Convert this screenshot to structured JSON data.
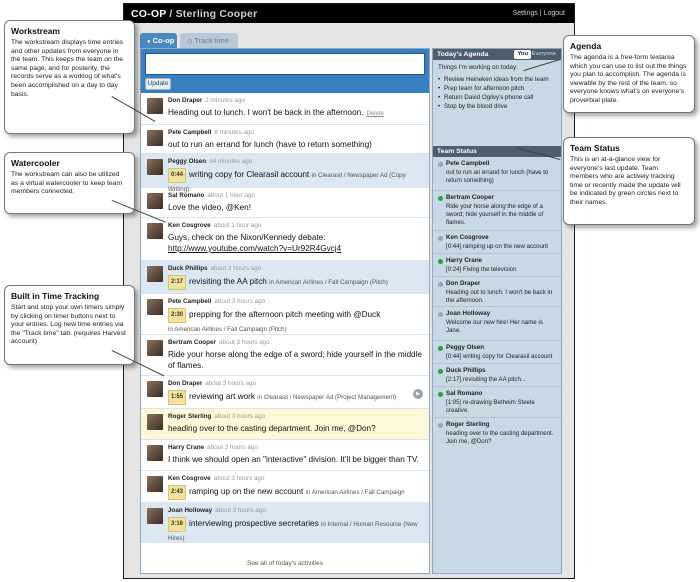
{
  "app": {
    "brand": "CO-OP",
    "separator": " / ",
    "team": "Sterling Cooper",
    "settings": "Settings",
    "links_sep": " | ",
    "logout": "Logout"
  },
  "tabs": {
    "coop": "Co-op",
    "track": "Track time"
  },
  "composer": {
    "update": "Update"
  },
  "entries": [
    {
      "name": "Don Draper",
      "ago": "2 minutes ago",
      "text": "Heading out to lunch. I won't be back in the afternoon.",
      "delete": "Delete"
    },
    {
      "name": "Pete Campbell",
      "ago": "8 minutes ago",
      "text": "out to run an errand for lunch (have to return something)"
    },
    {
      "name": "Peggy Olsen",
      "ago": "34 minutes ago",
      "timer": "0:44",
      "text": "writing copy for Clearasil account",
      "project": "in Clearasil / Newspaper Ad (Copy Writing)"
    },
    {
      "name": "Sal Romano",
      "ago": "about 1 hour ago",
      "text": "Love the video, @Ken!"
    },
    {
      "name": "Ken Cosgrove",
      "ago": "about 1 hour ago",
      "text": "Guys, check on the Nixon/Kennedy debate:",
      "link": "http://www.youtube.com/watch?v=Ur92R4Gvcj4"
    },
    {
      "name": "Duck Phillips",
      "ago": "about 2 hours ago",
      "timer": "2:17",
      "text": "revisiting the AA pitch",
      "project": "in American Airlines / Fall Campaign (Pitch)"
    },
    {
      "name": "Pete Campbell",
      "ago": "about 3 hours ago",
      "timer": "2:30",
      "text": "prepping for the afternoon pitch meeting with @Duck",
      "project": "in American Airlines / Fall Campaign (Pitch)"
    },
    {
      "name": "Bertram Cooper",
      "ago": "about 3 hours ago",
      "text": "Ride your horse along the edge of a sword; hide yourself in the middle of flames."
    },
    {
      "name": "Don Draper",
      "ago": "about 3 hours ago",
      "timer": "1:55",
      "text": "reviewing art work",
      "project": "in Clearasil / Newspaper Ad (Project Management)"
    },
    {
      "name": "Roger Sterling",
      "ago": "about 3 hours ago",
      "text": "heading over to the casting department. Join me, @Don?"
    },
    {
      "name": "Harry Crane",
      "ago": "about 3 hours ago",
      "text": "I think we should open an \"interactive\" division. It'll be bigger than TV."
    },
    {
      "name": "Ken Cosgrove",
      "ago": "about 3 hours ago",
      "timer": "2:43",
      "text": "ramping up on the new account",
      "project": "in American Airlines / Fall Campaign (Pitch)"
    },
    {
      "name": "Joan Holloway",
      "ago": "about 3 hours ago",
      "timer": "3:18",
      "text": "interviewing prospective secretaries",
      "project": "in Internal / Human Resource (New Hires)"
    }
  ],
  "see_all": "See all of today's activities",
  "agenda": {
    "title": "Today's Agenda",
    "you": "You",
    "everyone": "Everyone",
    "intro": "Things I'm working on today:",
    "items": [
      "Review Heineken ideas from the team",
      "Prep team for afternoon pitch",
      "Return David Ogilvy's phone call",
      "Stop by the blood drive"
    ]
  },
  "team_status": {
    "title": "Team Status",
    "members": [
      {
        "name": "Pete Campbell",
        "text": "out to run an errand for lunch (have to return something)",
        "active": false
      },
      {
        "name": "Bertram Cooper",
        "text": "Ride your horse along the edge of a sword; hide yourself in the middle of flames.",
        "active": true
      },
      {
        "name": "Ken Cosgrove",
        "text": "[0:44] ramping up on the new account",
        "active": false
      },
      {
        "name": "Harry Crane",
        "text": "[0:24] Fixing the television",
        "active": true
      },
      {
        "name": "Don Draper",
        "text": "Heading out to lunch. I won't be back in the afternoon.",
        "active": false
      },
      {
        "name": "Joan Holloway",
        "text": "Welcome our new hire! Her name is Jane.",
        "active": false
      },
      {
        "name": "Peggy Olsen",
        "text": "[0:44] writing copy for Clearasil account",
        "active": true
      },
      {
        "name": "Duck Phillips",
        "text": "[2:17] revisiting the AA pitch...",
        "active": true
      },
      {
        "name": "Sal Romano",
        "text": "[1:05] re-drawing Betheim Steele creative.",
        "active": true
      },
      {
        "name": "Roger Sterling",
        "text": "heading over to the casting department. Join me, @Don?",
        "active": false
      }
    ]
  },
  "callouts": {
    "workstream": {
      "title": "Workstream",
      "text": "The workstream displays time entries and other updates from everyone in the team. This keeps the team on the same page, and for posterity, the records serve as a worklog of what's been accomplished on a day to day basis."
    },
    "watercooler": {
      "title": "Watercooler",
      "text": "The workstream can also be utilized as a virtual watercooler to keep team members connected."
    },
    "tracking": {
      "title": "Built in Time Tracking",
      "text": "Start and stop your own timers simply by clicking on timer buttons next to your entries. Log new time entries via the \"Track time\" tab. (requires Harvest account)"
    },
    "agenda": {
      "title": "Agenda",
      "text": "The agenda is a free-form textarea which you can use to list out the things you plan to accomplish. The agenda is viewable by the rest of the team, so everyone knows what's on everyone's proverbial plate."
    },
    "team_status": {
      "title": "Team Status",
      "text": "This is an at-a-glance view for everyone's last update. Team members who are actively tracking time or recently made the update will be indicated by green circles next to their names."
    }
  }
}
